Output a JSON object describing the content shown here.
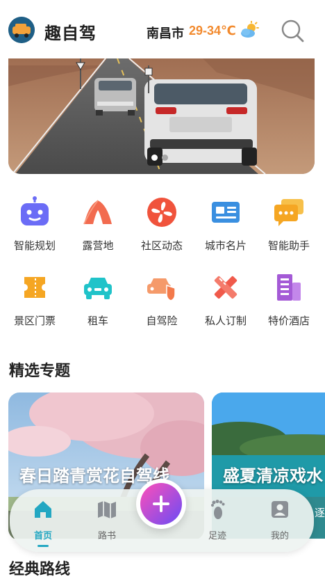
{
  "header": {
    "app_name": "趣自驾",
    "logo_text": "趣自驾",
    "city": "南昌市",
    "temperature": "29-34℃",
    "weather_icon": "partly-cloudy-icon",
    "search_icon": "search-icon"
  },
  "banner": {
    "slide_count": 2,
    "active_slide": 1
  },
  "features": [
    {
      "label": "智能规划",
      "icon": "robot-icon",
      "color": "#6b6cf6"
    },
    {
      "label": "露营地",
      "icon": "tent-icon",
      "color": "#f26b4f"
    },
    {
      "label": "社区动态",
      "icon": "fan-icon",
      "color": "#f0533c"
    },
    {
      "label": "城市名片",
      "icon": "id-card-icon",
      "color": "#3a8fe0"
    },
    {
      "label": "智能助手",
      "icon": "chat-icon",
      "color": "#f5a623"
    },
    {
      "label": "景区门票",
      "icon": "ticket-icon",
      "color": "#f5a623"
    },
    {
      "label": "租车",
      "icon": "car-icon",
      "color": "#20c3c9"
    },
    {
      "label": "自驾险",
      "icon": "car-shield-icon",
      "color": "#f37a4b"
    },
    {
      "label": "私人订制",
      "icon": "design-tools-icon",
      "color": "#f05a4b"
    },
    {
      "label": "特价酒店",
      "icon": "hotel-icon",
      "color": "#a45ad6"
    }
  ],
  "featured": {
    "title": "精选专题",
    "cards": [
      {
        "title": "春日踏青赏花自驾线"
      },
      {
        "title": "盛夏清凉戏水",
        "subtitle": "逐浪"
      }
    ]
  },
  "nav": {
    "items": [
      {
        "label": "首页",
        "icon": "home-icon",
        "active": true
      },
      {
        "label": "路书",
        "icon": "map-icon",
        "active": false
      },
      {
        "label": "足迹",
        "icon": "footprint-icon",
        "active": false
      },
      {
        "label": "我的",
        "icon": "profile-icon",
        "active": false
      }
    ],
    "fab_icon": "plus-icon"
  },
  "next_section": {
    "title": "经典路线"
  },
  "colors": {
    "accent": "#23a7c2",
    "temperature": "#f28a2e",
    "fab_start": "#ff4fb8",
    "fab_end": "#6a4cf5"
  }
}
